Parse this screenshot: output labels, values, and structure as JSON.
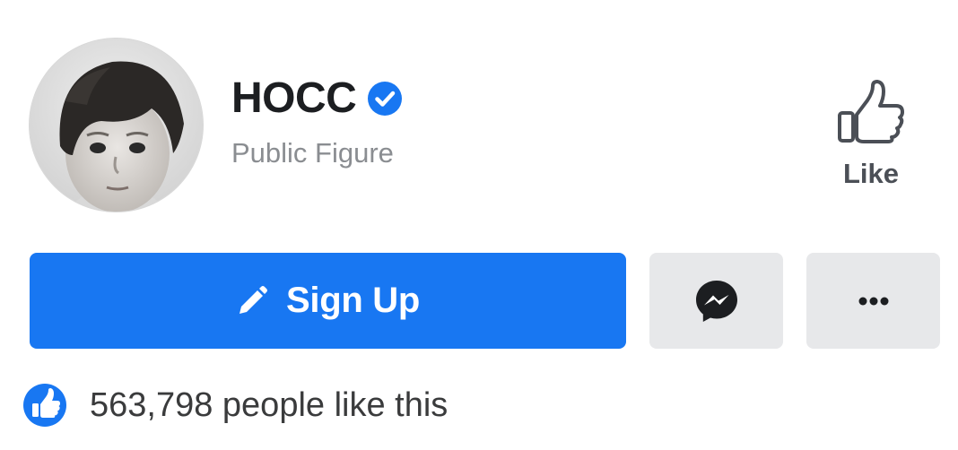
{
  "profile": {
    "name": "HOCC",
    "category": "Public Figure",
    "verified_icon": "verified-badge-icon",
    "avatar": "profile-photo-child-bw"
  },
  "like_action": {
    "icon": "thumbs-up-outline-icon",
    "label": "Like"
  },
  "actions": {
    "signup": {
      "icon": "pencil-icon",
      "label": "Sign Up"
    },
    "messenger": {
      "icon": "messenger-icon"
    },
    "more": {
      "icon": "more-dots-icon"
    }
  },
  "likes_summary": {
    "icon": "like-badge-icon",
    "text": "563,798 people like this"
  },
  "colors": {
    "brand_blue": "#1877f2",
    "secondary_button": "#e7e8ea",
    "secondary_text": "#8a8d91"
  }
}
